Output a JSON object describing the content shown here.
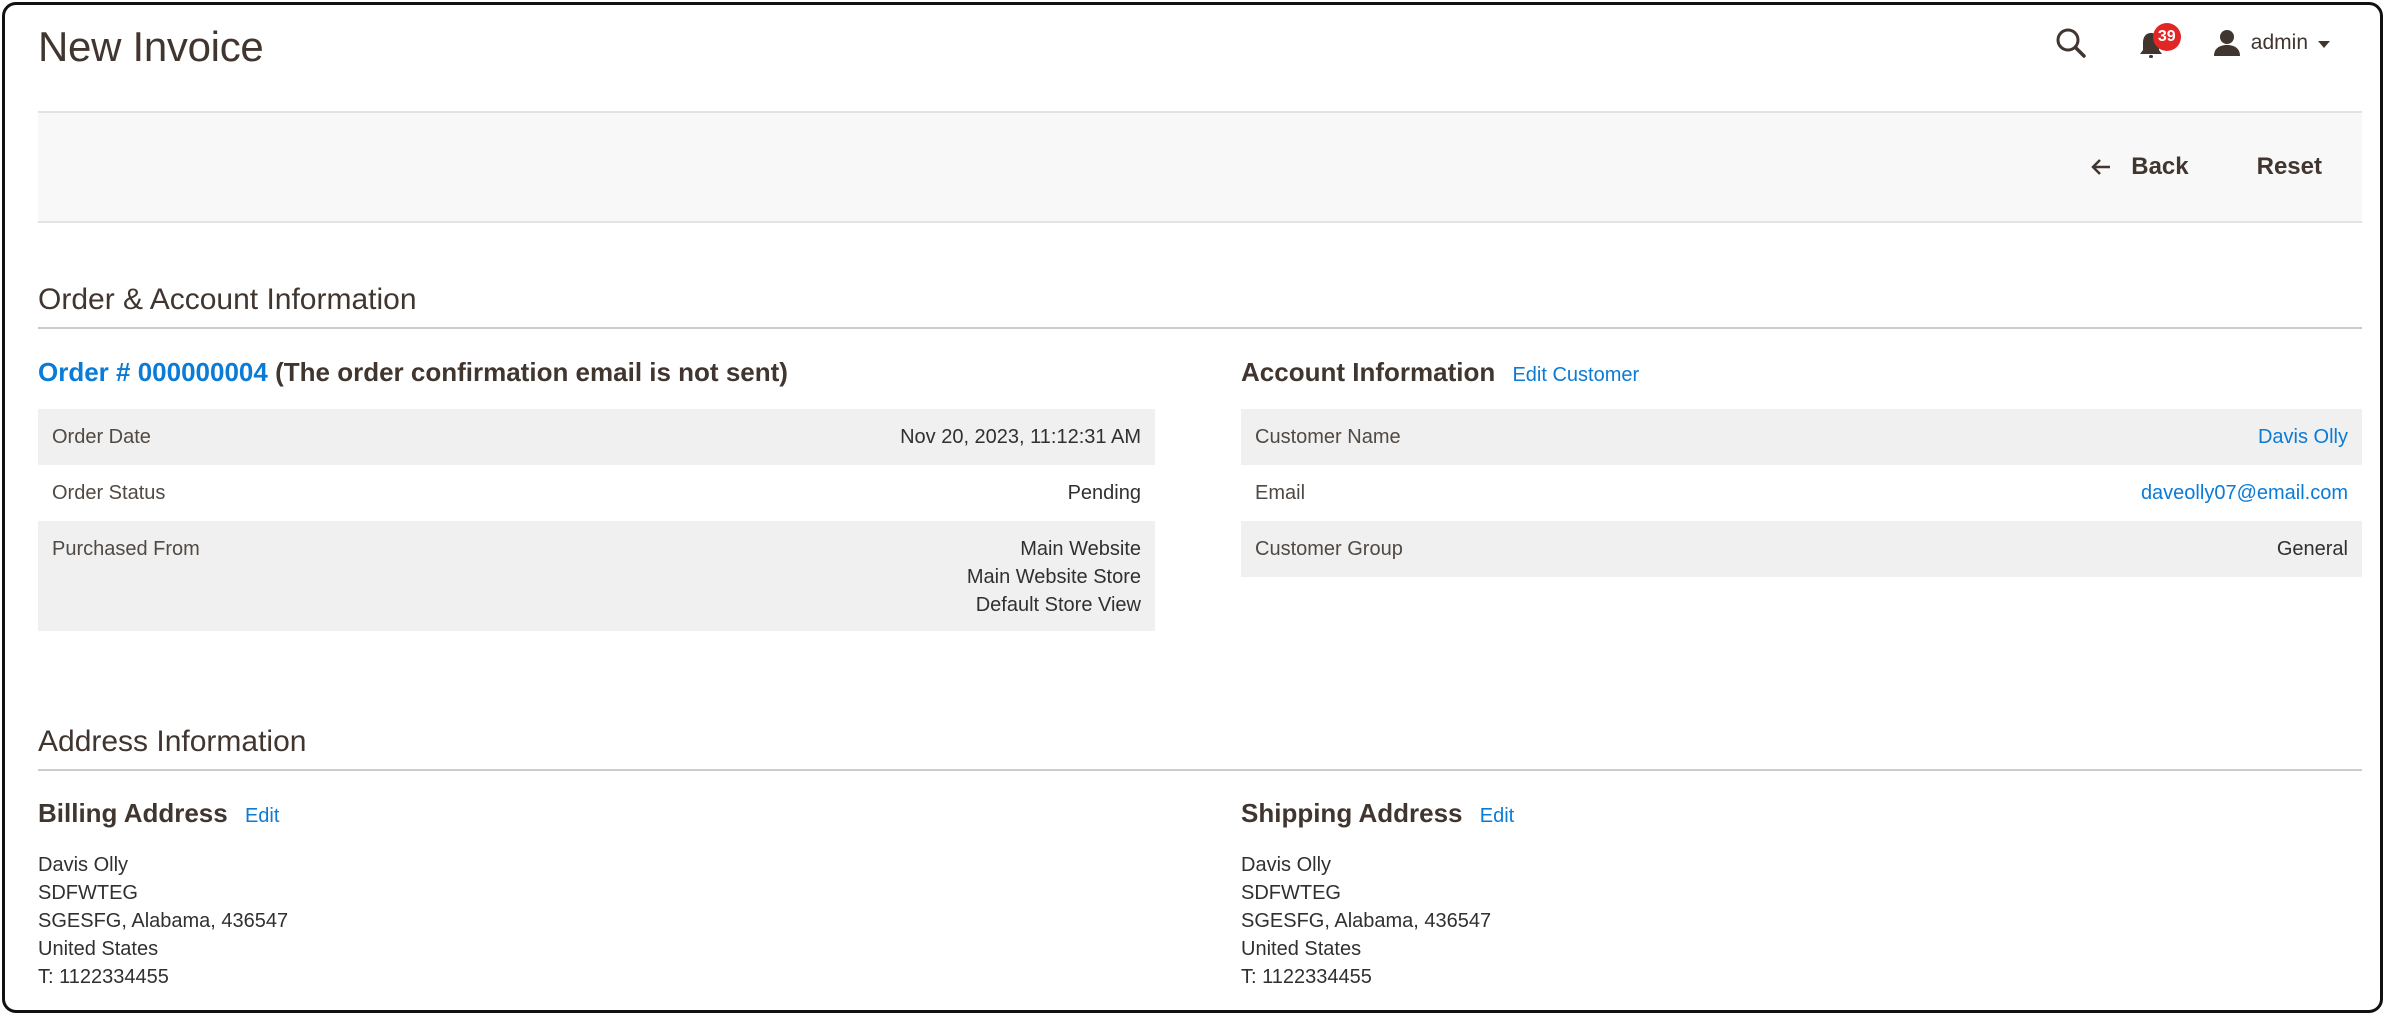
{
  "header": {
    "title": "New Invoice",
    "search_icon": "search-icon",
    "notifications": {
      "icon": "bell-icon",
      "count": "39"
    },
    "user": {
      "icon": "user-icon",
      "name": "admin",
      "dropdown_icon": "caret-down-icon"
    }
  },
  "toolbar": {
    "back_label": "Back",
    "back_icon": "arrow-left-icon",
    "reset_label": "Reset"
  },
  "order_account": {
    "section_title": "Order & Account Information",
    "order": {
      "order_link": "Order # 000000004",
      "note": "(The order confirmation email is not sent)",
      "rows": [
        {
          "label": "Order Date",
          "value": "Nov 20, 2023, 11:12:31 AM"
        },
        {
          "label": "Order Status",
          "value": "Pending"
        },
        {
          "label": "Purchased From",
          "values": [
            "Main Website",
            "Main Website Store",
            "Default Store View"
          ]
        }
      ]
    },
    "account": {
      "heading": "Account Information",
      "edit_link": "Edit Customer",
      "rows": [
        {
          "label": "Customer Name",
          "value": "Davis Olly"
        },
        {
          "label": "Email",
          "value": "daveolly07@email.com"
        },
        {
          "label": "Customer Group",
          "value": "General"
        }
      ]
    }
  },
  "address": {
    "section_title": "Address Information",
    "billing": {
      "heading": "Billing Address",
      "edit_link": "Edit",
      "lines": [
        "Davis Olly",
        "SDFWTEG",
        "SGESFG, Alabama, 436547",
        "United States",
        "T: 1122334455"
      ]
    },
    "shipping": {
      "heading": "Shipping Address",
      "edit_link": "Edit",
      "lines": [
        "Davis Olly",
        "SDFWTEG",
        "SGESFG, Alabama, 436547",
        "United States",
        "T: 1122334455"
      ]
    }
  },
  "colors": {
    "link": "#0a7bd6",
    "text": "#41362f",
    "badge": "#e22626",
    "row_stripe": "#f0f0f0",
    "toolbar_bg": "#f8f8f8"
  }
}
